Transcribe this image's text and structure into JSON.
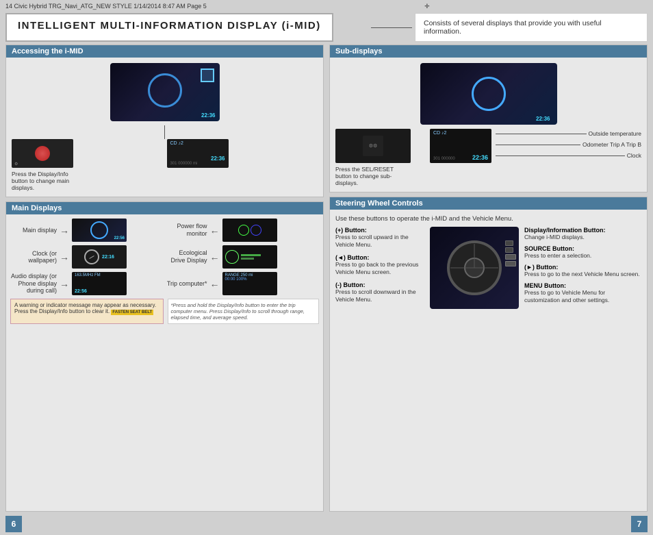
{
  "meta": {
    "file_info": "14 Civic Hybrid TRG_Navi_ATG_NEW STYLE  1/14/2014  8:47 AM  Page 5",
    "crosshair": "+"
  },
  "title": {
    "text": "INTELLIGENT MULTI-INFORMATION DISPLAY (i-MID)",
    "description": "Consists of several displays that provide you with useful information."
  },
  "left_page": {
    "page_number": "6",
    "accessing_imid": {
      "header": "Accessing the i-MID",
      "caption": "Press the Display/Info button to change main displays."
    },
    "main_displays": {
      "header": "Main Displays",
      "items_left": [
        {
          "label": "Main display"
        },
        {
          "label": "Clock\n(or wallpaper)"
        },
        {
          "label": "Audio display\n(or Phone\ndisplay during\ncall)"
        }
      ],
      "items_right": [
        {
          "label": "Power flow\nmonitor"
        },
        {
          "label": "Ecological\nDrive\nDisplay"
        },
        {
          "label": "Trip\ncomputer*"
        }
      ],
      "warning_text": "A warning or indicator message may appear as necessary. Press the Display/Info button to clear it.",
      "warning_icon_text": "FASTEN SEAT BELT",
      "footnote": "*Press and hold the Display/Info button to enter the trip computer menu. Press Display/Info to scroll through range, elapsed time, and average speed."
    }
  },
  "right_page": {
    "page_number": "7",
    "sub_displays": {
      "header": "Sub-displays",
      "caption": "Press the SEL/RESET button to change sub-displays.",
      "annotations": [
        "Outside temperature",
        "Odometer Trip A Trip B",
        "Clock"
      ]
    },
    "steering_controls": {
      "header": "Steering Wheel Controls",
      "intro": "Use these buttons to operate the i-MID and the Vehicle Menu.",
      "buttons_left": [
        {
          "label": "(+) Button:",
          "text": "Press to scroll upward in the Vehicle Menu."
        },
        {
          "label": "(◄) Button:",
          "text": "Press to go back to the previous Vehicle Menu screen."
        },
        {
          "label": "(-) Button:",
          "text": "Press to scroll downward in the Vehicle Menu."
        }
      ],
      "buttons_right": [
        {
          "label": "Display/Information Button:",
          "text": "Change i-MID displays."
        },
        {
          "label": "SOURCE Button:",
          "text": "Press to enter a selection."
        },
        {
          "label": "(►) Button:",
          "text": "Press to go to the next Vehicle Menu screen."
        },
        {
          "label": "MENU Button:",
          "text": "Press to go to Vehicle Menu for customization and other settings."
        }
      ]
    }
  },
  "colors": {
    "section_header_bg": "#4a7a9b",
    "page_num_bg": "#4a7a9b",
    "section_body_bg": "#e8e8e8",
    "warning_bg": "#f5e6c8",
    "title_bg": "#ffffff"
  }
}
